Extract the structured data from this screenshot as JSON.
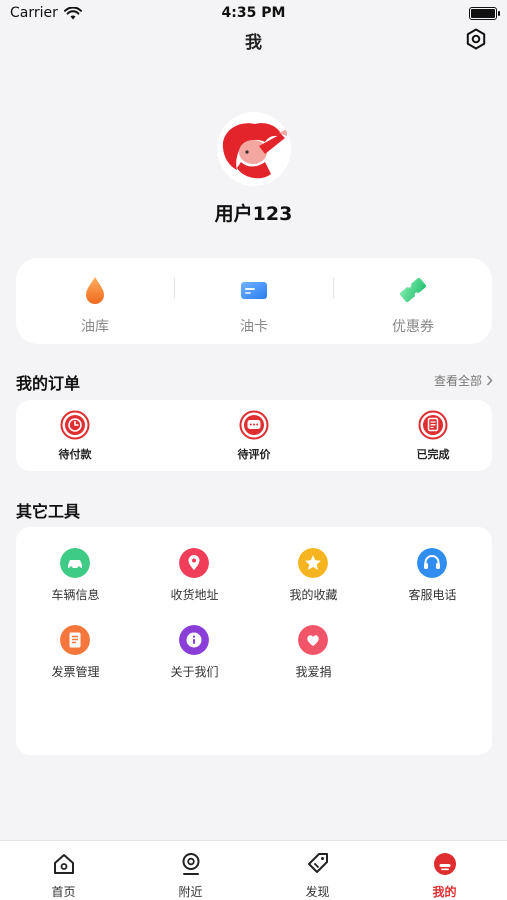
{
  "status_bar": {
    "carrier": "Carrier",
    "time": "4:35 PM"
  },
  "nav": {
    "title": "我",
    "settings_icon": "settings-icon"
  },
  "profile": {
    "username": "用户123",
    "avatar_icon": "avatar-illustration"
  },
  "wallet": [
    {
      "label": "油库",
      "icon": "oil-drop-icon",
      "color": "#f5832a"
    },
    {
      "label": "油卡",
      "icon": "card-icon",
      "color": "#3a8cf5"
    },
    {
      "label": "优惠券",
      "icon": "coupon-icon",
      "color": "#3ed08a"
    }
  ],
  "orders": {
    "title": "我的订单",
    "view_all": "查看全部",
    "items": [
      {
        "label": "待付款",
        "icon": "clock-icon"
      },
      {
        "label": "待评价",
        "icon": "comment-icon"
      },
      {
        "label": "已完成",
        "icon": "receipt-icon"
      }
    ],
    "accent": "#e02d30"
  },
  "tools": {
    "title": "其它工具",
    "items": [
      {
        "label": "车辆信息",
        "icon": "car-icon",
        "color": "#3ecb85"
      },
      {
        "label": "收货地址",
        "icon": "location-pin-icon",
        "color": "#ef3d5a"
      },
      {
        "label": "我的收藏",
        "icon": "star-icon",
        "color": "#f6b420"
      },
      {
        "label": "客服电话",
        "icon": "headset-icon",
        "color": "#2f8ef0"
      },
      {
        "label": "发票管理",
        "icon": "invoice-icon",
        "color": "#f5773b"
      },
      {
        "label": "关于我们",
        "icon": "info-icon",
        "color": "#8a3ed8"
      },
      {
        "label": "我爱捐",
        "icon": "heart-hand-icon",
        "color": "#f0556a"
      }
    ]
  },
  "tab_bar": {
    "items": [
      {
        "label": "首页",
        "icon": "home-icon",
        "active": false
      },
      {
        "label": "附近",
        "icon": "nearby-pin-icon",
        "active": false
      },
      {
        "label": "发现",
        "icon": "discover-tag-icon",
        "active": false
      },
      {
        "label": "我的",
        "icon": "profile-icon",
        "active": true
      }
    ],
    "active_color": "#e02d30"
  }
}
